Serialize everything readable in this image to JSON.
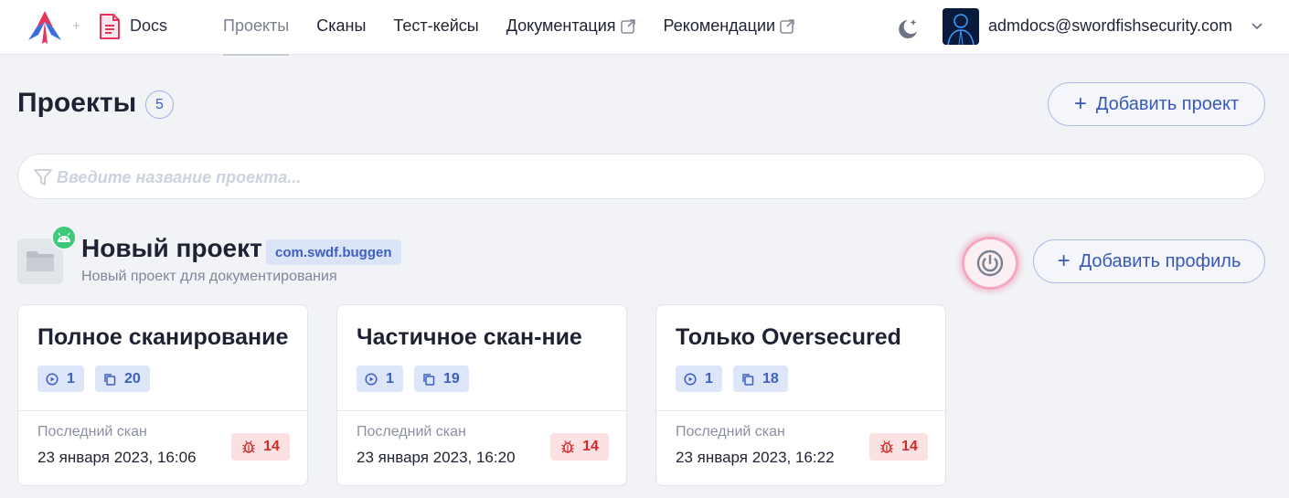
{
  "header": {
    "product_name": "Docs",
    "nav": [
      {
        "label": "Проекты",
        "active": true,
        "external": false
      },
      {
        "label": "Сканы",
        "active": false,
        "external": false
      },
      {
        "label": "Тест-кейсы",
        "active": false,
        "external": false
      },
      {
        "label": "Документация",
        "active": false,
        "external": true
      },
      {
        "label": "Рекомендации",
        "active": false,
        "external": true
      }
    ],
    "user_email": "admdocs@swordfishsecurity.com"
  },
  "page": {
    "title": "Проекты",
    "count": "5",
    "add_project_label": "Добавить проект"
  },
  "search": {
    "placeholder": "Введите название проекта..."
  },
  "project": {
    "name": "Новый проект",
    "package": "com.swdf.buggen",
    "description": "Новый проект для документирования",
    "platform_icon": "android-icon",
    "add_profile_label": "Добавить профиль"
  },
  "cards": [
    {
      "title": "Полное сканирование",
      "runs": "1",
      "copies": "20",
      "last_scan_label": "Последний скан",
      "last_scan_date": "23 января 2023, 16:06",
      "bugs": "14"
    },
    {
      "title": "Частичное скан-ние",
      "runs": "1",
      "copies": "19",
      "last_scan_label": "Последний скан",
      "last_scan_date": "23 января 2023, 16:20",
      "bugs": "14"
    },
    {
      "title": "Только Oversecured",
      "runs": "1",
      "copies": "18",
      "last_scan_label": "Последний скан",
      "last_scan_date": "23 января 2023, 16:22",
      "bugs": "14"
    }
  ],
  "colors": {
    "accent": "#3d5fc1",
    "android_green": "#3ec97a",
    "bug_red": "#d12a2a",
    "highlight_pink": "#f3a7c1"
  }
}
